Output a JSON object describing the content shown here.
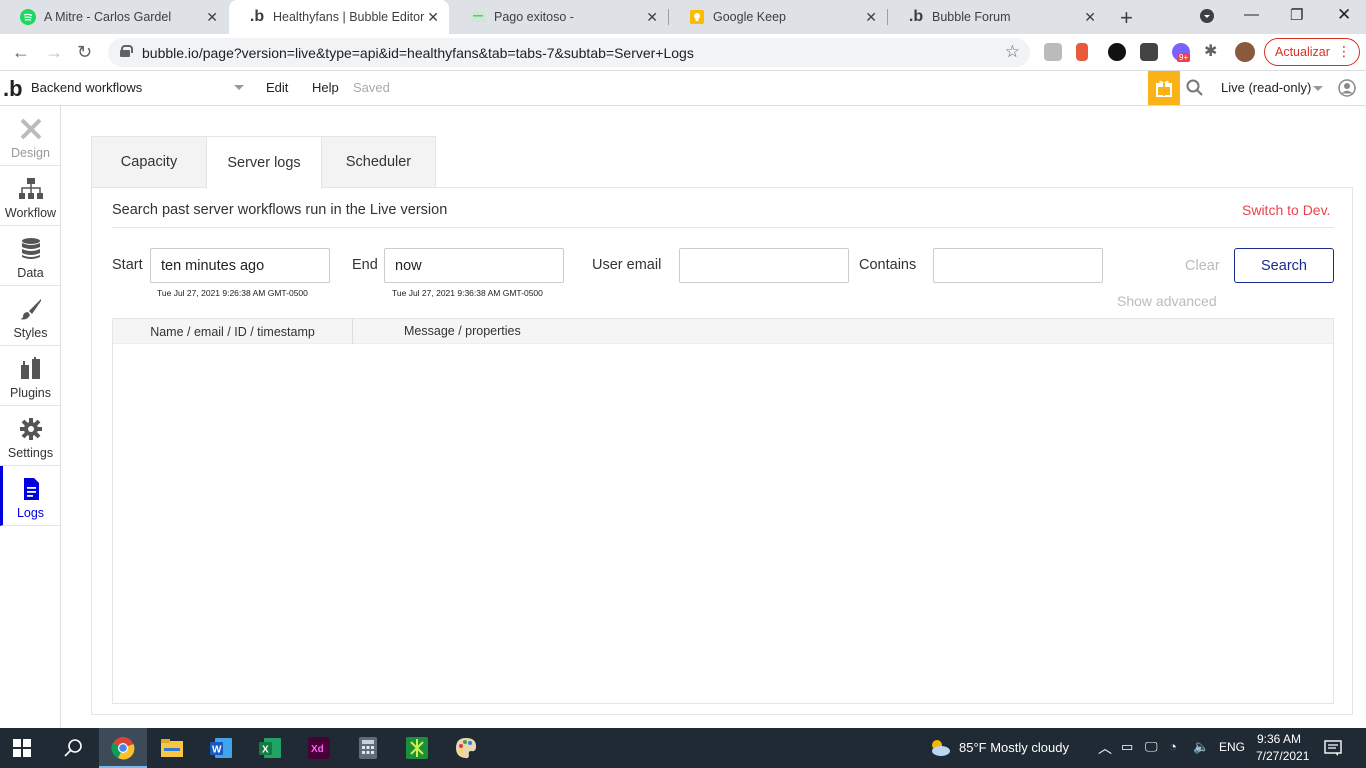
{
  "browser": {
    "tabs": [
      {
        "title": "A Mitre - Carlos Gardel",
        "icon": "spotify-icon"
      },
      {
        "title": "Healthyfans | Bubble Editor",
        "icon": "bubble-icon"
      },
      {
        "title": "Pago exitoso -",
        "icon": "page-icon"
      },
      {
        "title": "Google Keep",
        "icon": "keep-icon"
      },
      {
        "title": "Bubble Forum",
        "icon": "bubble-icon"
      }
    ],
    "url": "bubble.io/page?version=live&type=api&id=healthyfans&tab=tabs-7&subtab=Server+Logs",
    "update_label": "Actualizar",
    "ext_badge": "9+"
  },
  "editor": {
    "page_select": "Backend workflows",
    "menu": {
      "edit": "Edit",
      "help": "Help"
    },
    "saved": "Saved",
    "live_select": "Live (read-only)"
  },
  "sidebar": {
    "items": [
      {
        "label": "Design"
      },
      {
        "label": "Workflow"
      },
      {
        "label": "Data"
      },
      {
        "label": "Styles"
      },
      {
        "label": "Plugins"
      },
      {
        "label": "Settings"
      },
      {
        "label": "Logs"
      }
    ]
  },
  "logs": {
    "tabs": [
      {
        "label": "Capacity"
      },
      {
        "label": "Server logs"
      },
      {
        "label": "Scheduler"
      }
    ],
    "description": "Search past server workflows run in the Live version",
    "switch_dev": "Switch to Dev.",
    "start": {
      "label": "Start",
      "value": "ten minutes ago",
      "resolved": "Tue Jul 27, 2021 9:26:38 AM GMT-0500"
    },
    "end": {
      "label": "End",
      "value": "now",
      "resolved": "Tue Jul 27, 2021 9:36:38 AM GMT-0500"
    },
    "user_email": {
      "label": "User email",
      "value": ""
    },
    "contains": {
      "label": "Contains",
      "value": ""
    },
    "clear": "Clear",
    "search": "Search",
    "show_advanced": "Show advanced",
    "columns": [
      "Name / email / ID / timestamp",
      "Message / properties"
    ]
  },
  "taskbar": {
    "weather": "85°F  Mostly cloudy",
    "lang": "ENG",
    "time": "9:36 AM",
    "date": "7/27/2021"
  },
  "colors": {
    "accent_blue": "#1a2b8f",
    "switch_red": "#e8434d",
    "gift_yellow": "#fbb216",
    "logs_active": "#0000dd"
  }
}
